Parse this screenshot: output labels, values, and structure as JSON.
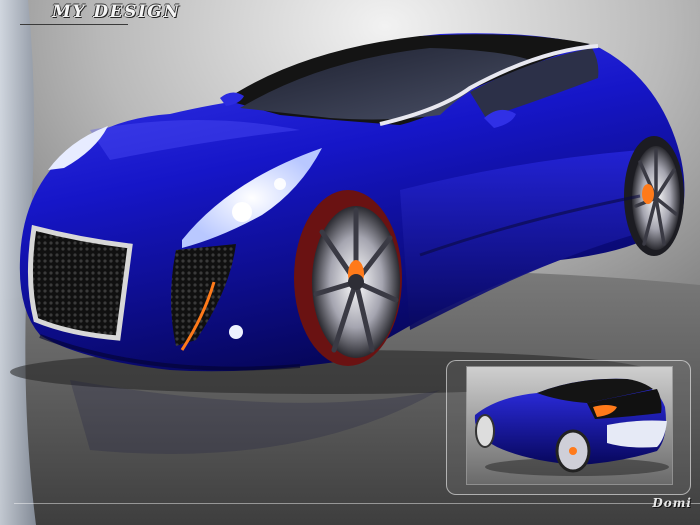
{
  "header": {
    "title": "MY DESIGN"
  },
  "footer": {
    "signature": "Domi"
  },
  "colors": {
    "body_paint": "#1a1ad0",
    "body_shadow": "#05054a",
    "accent_orange": "#ff7a1a",
    "chrome": "#d8d8d8"
  },
  "scene": {
    "main_subject": "blue-concept-car-front-three-quarter",
    "inset_subject": "blue-concept-car-rear-three-quarter"
  }
}
